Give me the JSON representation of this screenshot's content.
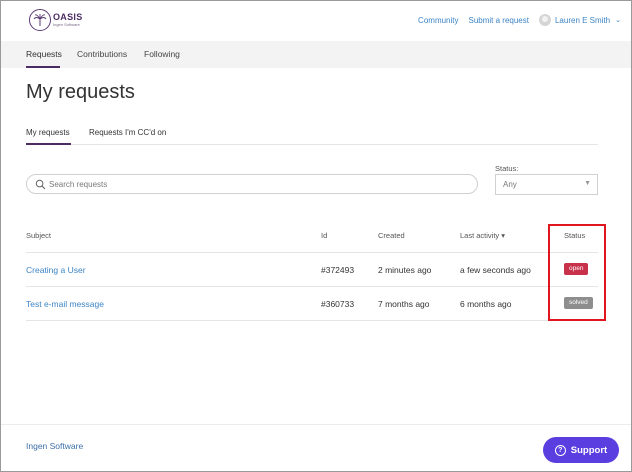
{
  "header": {
    "logo_name": "OASIS",
    "logo_sub": "Ingen Software",
    "nav": [
      "Community",
      "Submit a request"
    ],
    "user_name": "Lauren E Smith"
  },
  "subnav": [
    "Requests",
    "Contributions",
    "Following"
  ],
  "page_title": "My requests",
  "tabs": [
    "My requests",
    "Requests I'm CC'd on"
  ],
  "search": {
    "placeholder": "Search requests"
  },
  "status_filter": {
    "label": "Status:",
    "value": "Any"
  },
  "table": {
    "columns": [
      "Subject",
      "Id",
      "Created",
      "Last activity ▾",
      "Status"
    ],
    "rows": [
      {
        "subject": "Creating a User",
        "id": "#372493",
        "created": "2 minutes ago",
        "last_activity": "a few seconds ago",
        "status": "open"
      },
      {
        "subject": "Test e-mail message",
        "id": "#360733",
        "created": "7 months ago",
        "last_activity": "6 months ago",
        "status": "solved"
      }
    ]
  },
  "footer": {
    "text": "Ingen Software",
    "support_label": "Support"
  },
  "colors": {
    "brand": "#4b2c63",
    "link": "#3d84c6",
    "open_badge": "#c7314a",
    "solved_badge": "#8e8e8e",
    "support_button": "#5b3ee0",
    "highlight": "#e0161f"
  }
}
